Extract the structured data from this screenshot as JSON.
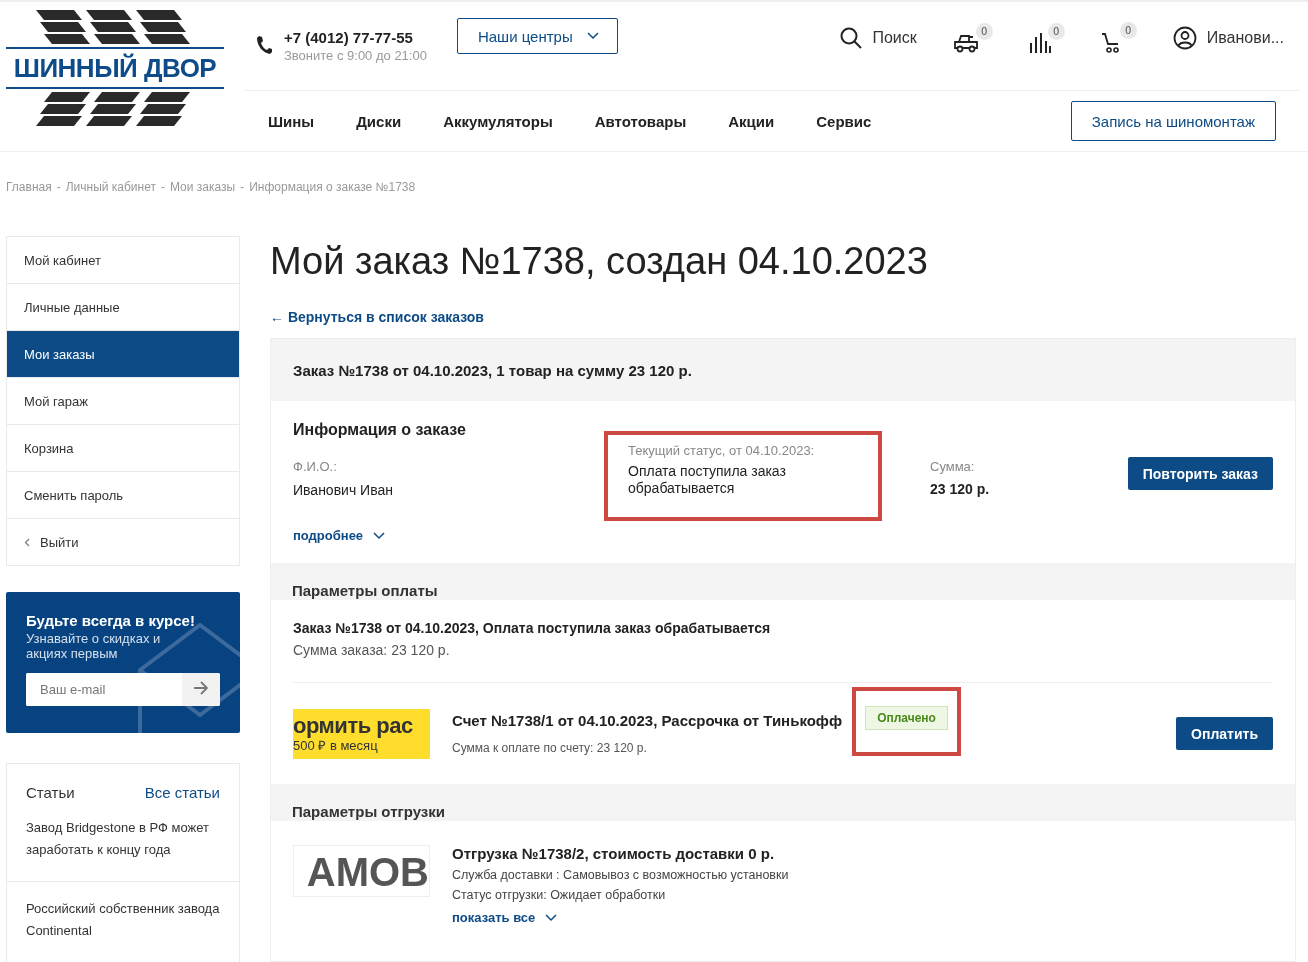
{
  "header": {
    "logo": {
      "text": "ШИННЫЙ ДВОР"
    },
    "phone": "+7 (4012) 77-77-55",
    "phone_hours": "Звоните с 9:00 до 21:00",
    "centers_button": "Наши центры",
    "search": "Поиск",
    "counters": [
      {
        "kind": "garage",
        "count": "0"
      },
      {
        "kind": "compare",
        "count": "0"
      },
      {
        "kind": "cart",
        "count": "0"
      }
    ],
    "user": "Иванови...",
    "nav": [
      "Шины",
      "Диски",
      "Аккумуляторы",
      "Автотовары",
      "Акции",
      "Сервис"
    ],
    "booking_button": "Запись на шиномонтаж"
  },
  "breadcrumb_separator": "-",
  "breadcrumbs": [
    "Главная",
    "Личный кабинет",
    "Мои заказы",
    "Информация о заказе №1738"
  ],
  "sidebar": {
    "items": [
      {
        "label": "Мой кабинет",
        "selected": false
      },
      {
        "label": "Личные данные",
        "selected": false
      },
      {
        "label": "Мои заказы",
        "selected": true
      },
      {
        "label": "Мой гараж",
        "selected": false
      },
      {
        "label": "Корзина",
        "selected": false
      },
      {
        "label": "Сменить пароль",
        "selected": false
      },
      {
        "label": "Выйти",
        "selected": false,
        "kind": "back"
      }
    ]
  },
  "newsletter": {
    "title": "Будьте всегда в курсе!",
    "text": "Узнавайте о скидках и акциях первым",
    "placeholder": "Ваш e-mail"
  },
  "articles": {
    "title": "Статьи",
    "all_link": "Все статьи",
    "items": [
      "Завод Bridgestone в РФ может заработать к концу года",
      "Российский собственник завода Continental"
    ]
  },
  "page_title": "Мой заказ №1738, создан 04.10.2023",
  "back_link": "← Вернуться в список заказов",
  "order": {
    "summary": "Заказ №1738 от 04.10.2023, 1 товар на сумму 23 120 р.",
    "info_title": "Информация о заказе",
    "name_label": "Ф.И.О.:",
    "name": "Иванович Иван",
    "more_link": "подробнее",
    "status_label": "Текущий статус, от 04.10.2023:",
    "status": "Оплата поступила заказ обрабатывается",
    "status_highlighted": true,
    "sum_label": "Сумма:",
    "sum": "23 120 р.",
    "repeat_button": "Повторить заказ"
  },
  "payment": {
    "title": "Параметры оплаты",
    "heading": "Заказ №1738 от 04.10.2023, Оплата поступила заказ обрабатывается",
    "sum_line": "Сумма заказа: 23 120 р.",
    "invoice": {
      "image_line1": "ормить рас",
      "image_line2": "500 ₽ в месяц",
      "title": "Счет №1738/1 от 04.10.2023, Рассрочка от Тинькофф",
      "badge": "Оплачено",
      "paid": true,
      "badge_highlighted": true,
      "sum": "Сумма к оплате по счету: 23 120 р.",
      "pay_button": "Оплатить"
    }
  },
  "shipping": {
    "title": "Параметры отгрузки",
    "image_text": "АМОВ",
    "heading": "Отгрузка №1738/2, стоимость доставки 0 р.",
    "service": "Служба доставки : Самовывоз с возможностью установки",
    "status": "Статус отгрузки: Ожидает обработки",
    "show_all": "показать все"
  }
}
